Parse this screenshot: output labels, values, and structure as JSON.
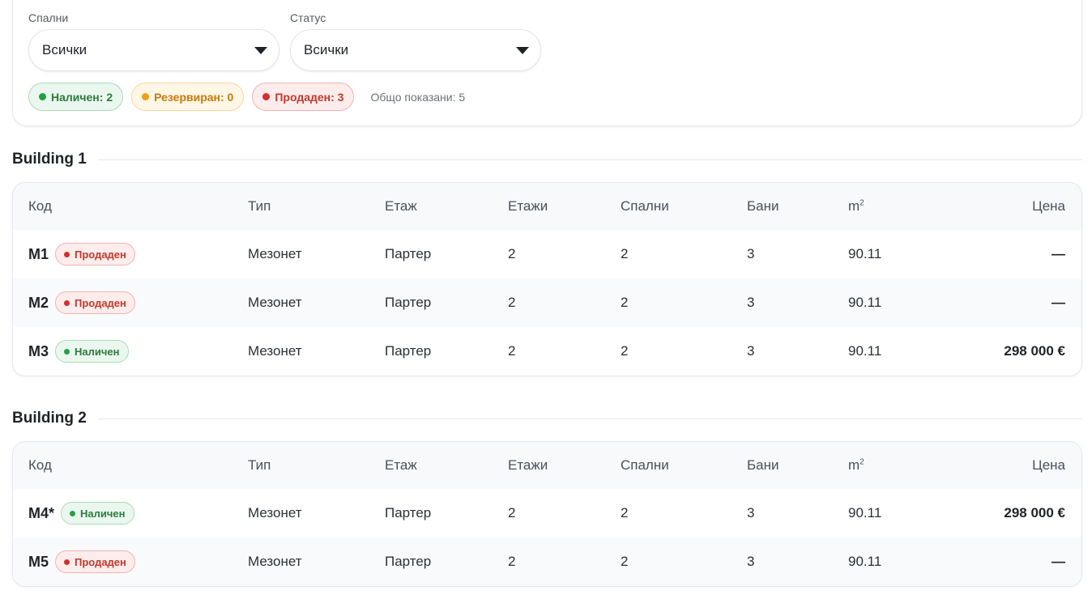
{
  "filters": {
    "bedrooms_label": "Спални",
    "bedrooms_value": "Всички",
    "status_label": "Статус",
    "status_value": "Всички"
  },
  "summary": {
    "available": "Наличен: 2",
    "reserved": "Резервиран: 0",
    "sold": "Продаден: 3",
    "total": "Общо показани: 5"
  },
  "columns": {
    "code": "Код",
    "type": "Тип",
    "floor": "Етаж",
    "floors": "Етажи",
    "bedrooms": "Спални",
    "bathrooms": "Бани",
    "area": "m",
    "area_sup": "2",
    "price": "Цена"
  },
  "status_labels": {
    "sold": "Продаден",
    "available": "Наличен"
  },
  "colors": {
    "available": "#22a045",
    "reserved": "#f39c12",
    "sold": "#d62d2d"
  },
  "groups": [
    {
      "title": "Building 1",
      "rows": [
        {
          "code": "M1",
          "status": "Продаден",
          "type": "Мезонет",
          "floor": "Партер",
          "floors": "2",
          "bedrooms": "2",
          "bathrooms": "3",
          "area": "90.11",
          "price": "—"
        },
        {
          "code": "M2",
          "status": "Продаден",
          "type": "Мезонет",
          "floor": "Партер",
          "floors": "2",
          "bedrooms": "2",
          "bathrooms": "3",
          "area": "90.11",
          "price": "—"
        },
        {
          "code": "M3",
          "status": "Наличен",
          "type": "Мезонет",
          "floor": "Партер",
          "floors": "2",
          "bedrooms": "2",
          "bathrooms": "3",
          "area": "90.11",
          "price": "298 000 €"
        }
      ]
    },
    {
      "title": "Building 2",
      "rows": [
        {
          "code": "M4*",
          "status": "Наличен",
          "type": "Мезонет",
          "floor": "Партер",
          "floors": "2",
          "bedrooms": "2",
          "bathrooms": "3",
          "area": "90.11",
          "price": "298 000 €"
        },
        {
          "code": "M5",
          "status": "Продаден",
          "type": "Мезонет",
          "floor": "Партер",
          "floors": "2",
          "bedrooms": "2",
          "bathrooms": "3",
          "area": "90.11",
          "price": "—"
        }
      ]
    }
  ]
}
